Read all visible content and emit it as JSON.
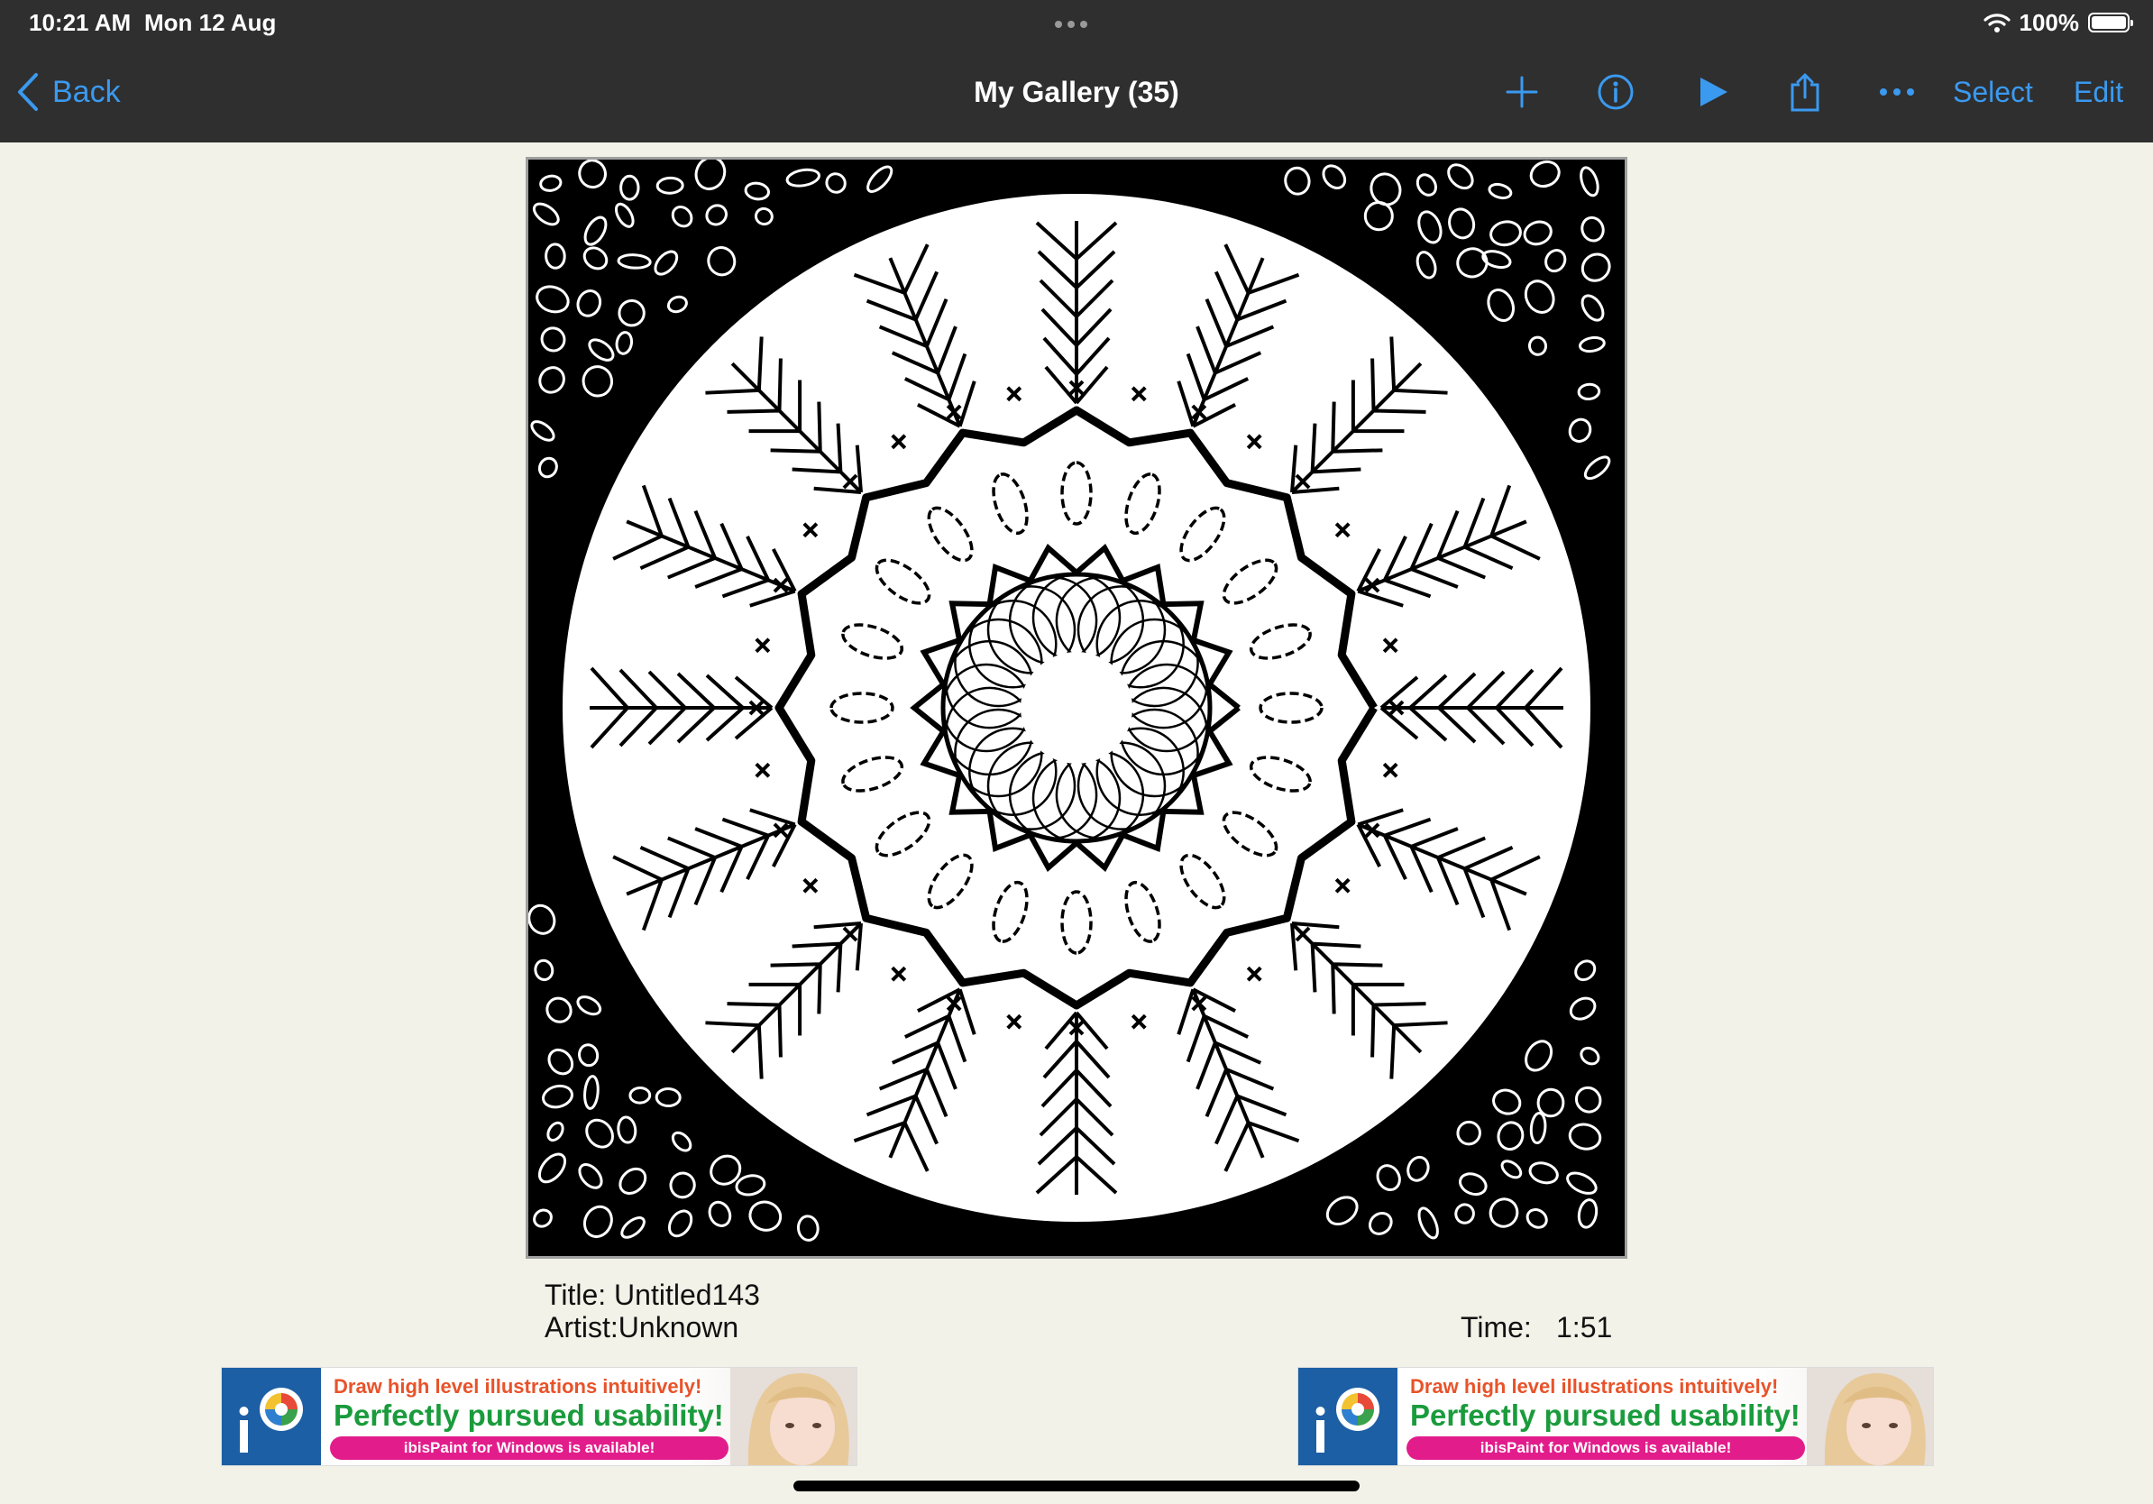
{
  "status_bar": {
    "time": "10:21 AM",
    "date": "Mon 12 Aug",
    "battery": "100%"
  },
  "toolbar": {
    "back_label": "Back",
    "title": "My Gallery (35)",
    "select_label": "Select",
    "edit_label": "Edit",
    "icons": [
      "plus-icon",
      "info-icon",
      "play-icon",
      "share-icon",
      "more-icon"
    ]
  },
  "artwork": {
    "title_text": "Title: Untitled143",
    "artist_text": "Artist:Unknown",
    "time_label": "Time:",
    "time_value": "1:51"
  },
  "ads": [
    {
      "line1": "Draw high level illustrations intuitively!",
      "line2": "Perfectly pursued usability!",
      "pill": "ibisPaint for Windows is available!"
    },
    {
      "line1": "Draw high level illustrations intuitively!",
      "line2": "Perfectly pursued usability!",
      "pill": "ibisPaint for Windows is available!"
    }
  ],
  "colors": {
    "accent": "#3a9af0",
    "toolbar_bg": "#2f2f2f",
    "page_bg": "#f3f2e8"
  }
}
